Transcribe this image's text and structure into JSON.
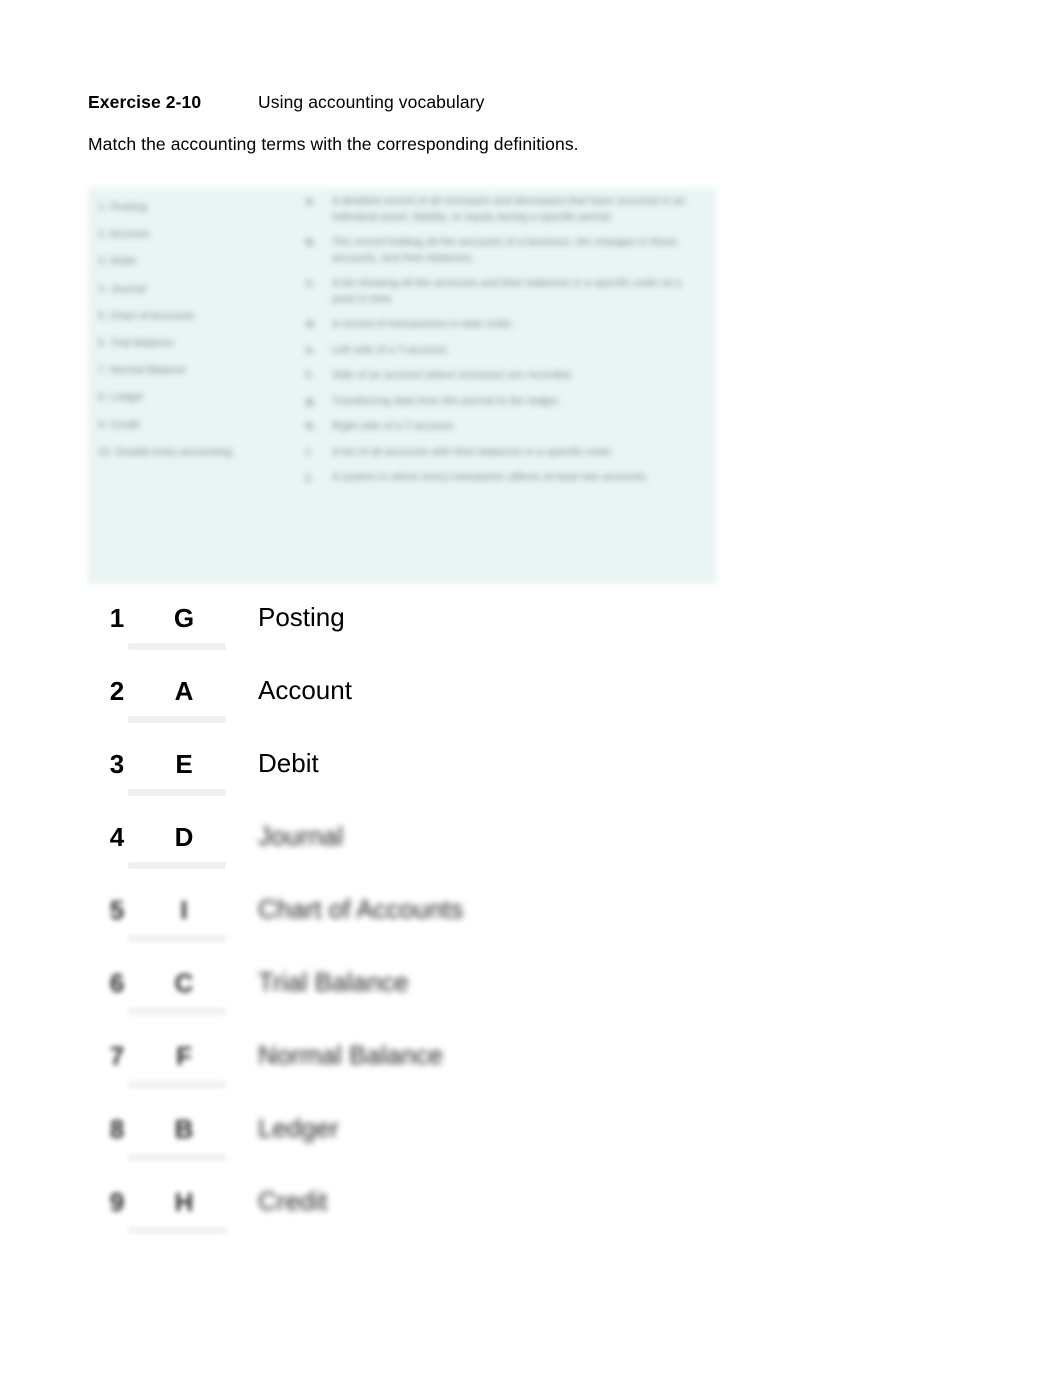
{
  "document": {
    "heading": {
      "exercise_label": "Exercise 2-10",
      "exercise_title": "Using accounting vocabulary"
    },
    "instruction": "Match the accounting terms with the corresponding definitions."
  },
  "exhibit": {
    "background_color": "#e9f4f3",
    "redacted": true,
    "terms": [
      "1. Posting",
      "2. Account",
      "3. Debit",
      "4. Journal",
      "5. Chart of Accounts",
      "6. Trial Balance",
      "7. Normal Balance",
      "8. Ledger",
      "9. Credit",
      "10. Double-entry accounting"
    ],
    "definitions": [
      {
        "letter": "a.",
        "text": "A detailed record of all increases and decreases that have occurred in an individual asset, liability, or equity during a specific period."
      },
      {
        "letter": "b.",
        "text": "The record holding all the accounts of a business, the changes in those accounts, and their balances."
      },
      {
        "letter": "c.",
        "text": "A list showing all the accounts and their balances in a specific order at a point in time."
      },
      {
        "letter": "d.",
        "text": "A record of transactions in date order."
      },
      {
        "letter": "e.",
        "text": "Left side of a T-account."
      },
      {
        "letter": "f.",
        "text": "Side of an account where increases are recorded."
      },
      {
        "letter": "g.",
        "text": "Transferring data from the journal to the ledger."
      },
      {
        "letter": "h.",
        "text": "Right side of a T-account."
      },
      {
        "letter": "i.",
        "text": "A list of all accounts with their balances in a specific order."
      },
      {
        "letter": "j.",
        "text": "A system in which every transaction affects at least two accounts."
      }
    ]
  },
  "answers": {
    "rows": [
      {
        "number": "1",
        "letter": "G",
        "term": "Posting",
        "redacted_letter": false,
        "redacted_term": false
      },
      {
        "number": "2",
        "letter": "A",
        "term": "Account",
        "redacted_letter": false,
        "redacted_term": false
      },
      {
        "number": "3",
        "letter": "E",
        "term": "Debit",
        "redacted_letter": false,
        "redacted_term": false
      },
      {
        "number": "4",
        "letter": "D",
        "term": "Journal",
        "redacted_letter": false,
        "redacted_term": true
      },
      {
        "number": "5",
        "letter": "I",
        "term": "Chart of Accounts",
        "redacted_letter": true,
        "redacted_term": true
      },
      {
        "number": "6",
        "letter": "C",
        "term": "Trial Balance",
        "redacted_letter": true,
        "redacted_term": true
      },
      {
        "number": "7",
        "letter": "F",
        "term": "Normal Balance",
        "redacted_letter": true,
        "redacted_term": true
      },
      {
        "number": "8",
        "letter": "B",
        "term": "Ledger",
        "redacted_letter": true,
        "redacted_term": true
      },
      {
        "number": "9",
        "letter": "H",
        "term": "Credit",
        "redacted_letter": true,
        "redacted_term": true
      }
    ]
  }
}
